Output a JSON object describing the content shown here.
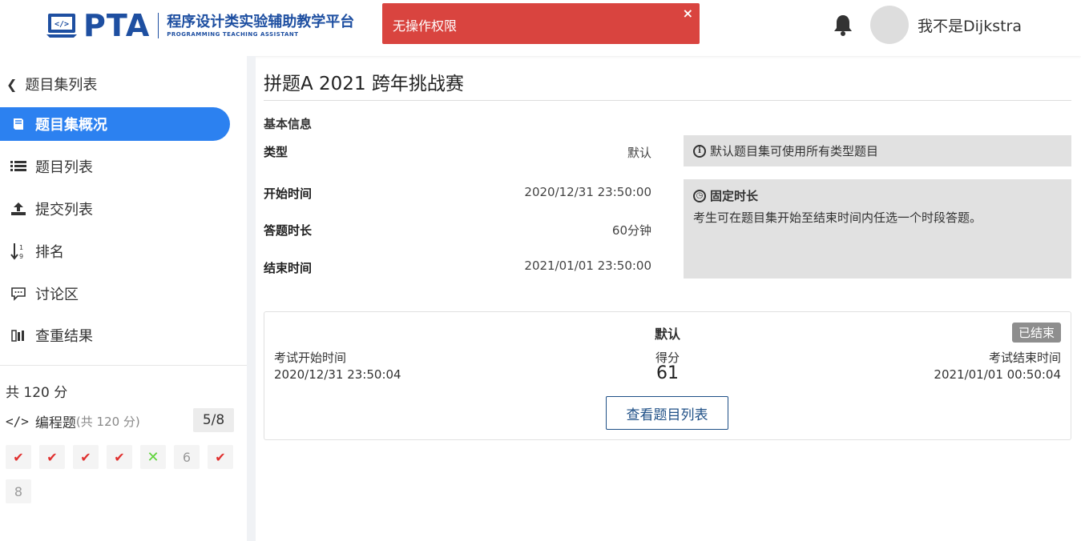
{
  "header": {
    "logo_text": "PTA",
    "logo_cn": "程序设计类实验辅助教学平台",
    "logo_en": "PROGRAMMING TEACHING ASSISTANT",
    "username": "我不是Dijkstra"
  },
  "toast": {
    "message": "无操作权限",
    "close": "×",
    "color": "#d9443f"
  },
  "sidebar": {
    "back_label": "题目集列表",
    "items": [
      {
        "label": "题目集概况",
        "icon": "book-icon",
        "active": true
      },
      {
        "label": "题目列表",
        "icon": "list-icon"
      },
      {
        "label": "提交列表",
        "icon": "upload-icon"
      },
      {
        "label": "排名",
        "icon": "sort-numeric-icon"
      },
      {
        "label": "讨论区",
        "icon": "comment-icon"
      },
      {
        "label": "查重结果",
        "icon": "similarity-icon"
      }
    ],
    "total": "共 120 分",
    "programming": {
      "label": "编程题",
      "sub": "(共 120 分)",
      "count": "5/8"
    },
    "questions": [
      {
        "text": "✔",
        "status": "correct"
      },
      {
        "text": "✔",
        "status": "correct"
      },
      {
        "text": "✔",
        "status": "correct"
      },
      {
        "text": "✔",
        "status": "correct"
      },
      {
        "text": "✕",
        "status": "wrong"
      },
      {
        "text": "6",
        "status": "none"
      },
      {
        "text": "✔",
        "status": "correct"
      },
      {
        "text": "8",
        "status": "none"
      }
    ],
    "accent": "#2c81f0"
  },
  "main": {
    "title": "拼题A 2021 跨年挑战赛",
    "basic_info": "基本信息",
    "fields": [
      {
        "label": "类型",
        "value": "默认"
      },
      {
        "label": "开始时间",
        "value": "2020/12/31 23:50:00"
      },
      {
        "label": "答题时长",
        "value": "60分钟"
      },
      {
        "label": "结束时间",
        "value": "2021/01/01 23:50:00"
      }
    ],
    "info_type": "默认题目集可使用所有类型题目",
    "info_mode_title": "固定时长",
    "info_mode_desc": "考生可在题目集开始至结束时间内任选一个时段答题。",
    "card": {
      "set_name": "默认",
      "status": "已结束",
      "start_label": "考试开始时间",
      "start_value": "2020/12/31 23:50:04",
      "score_label": "得分",
      "score_value": "61",
      "end_label": "考试结束时间",
      "end_value": "2021/01/01 00:50:04",
      "button": "查看题目列表"
    }
  }
}
